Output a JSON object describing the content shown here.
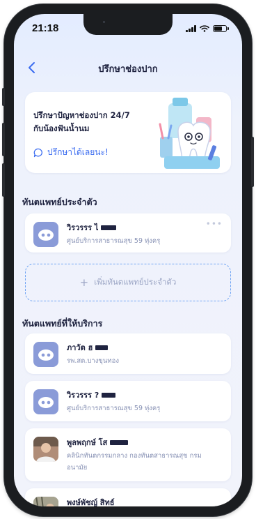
{
  "status": {
    "time": "21:18"
  },
  "header": {
    "title": "ปรึกษาช่องปาก"
  },
  "promo": {
    "line1": "ปรึกษาปัญหาช่องปาก 24/7",
    "line2": "กับน้องฟันน้ำนม",
    "cta": "ปรึกษาได้เลยนะ!"
  },
  "personal": {
    "heading": "ทันตแพทย์ประจำตัว",
    "doctor": {
      "name": "วิรวรรร ไ",
      "clinic": "ศูนย์บริการสาธารณสุข 59 ทุ่งครุ",
      "more": "•••"
    },
    "add_label": "เพิ่มทันตแพทย์ประจำตัว"
  },
  "providers": {
    "heading": "ทันตแพทย์ที่ให้บริการ",
    "items": [
      {
        "name": "ภาวัต ฮ",
        "clinic": "รพ.สต.บางขุนทอง"
      },
      {
        "name": "วิรวรรร ?",
        "clinic": "ศูนย์บริการสาธารณสุข 59 ทุ่งครุ"
      },
      {
        "name": "พูลพฤกษ์ โส",
        "clinic": "คลินิกทันตกรรมกลาง กองทันตสาธารณสุข กรมอนามัย"
      },
      {
        "name": "พงษ์พัชญ์ สิทธ์",
        "clinic": ""
      }
    ]
  },
  "colors": {
    "accent": "#3b6cf0",
    "dashed_border": "#6fa4f4",
    "avatar_bg": "#8a9bd8"
  }
}
